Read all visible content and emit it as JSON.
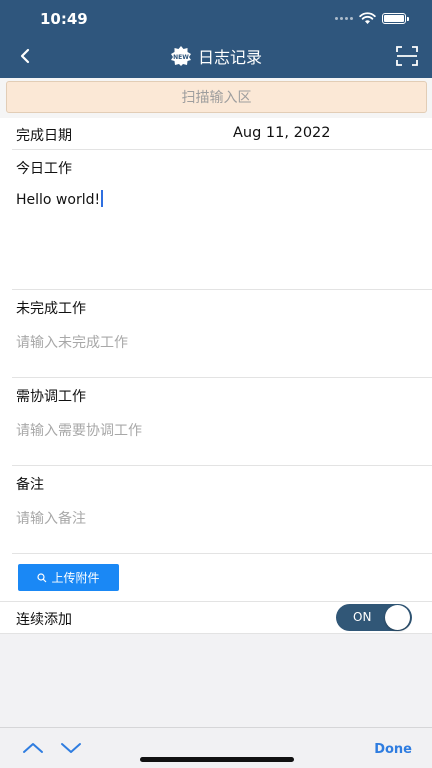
{
  "status": {
    "time": "10:49"
  },
  "header": {
    "title": "日志记录",
    "badge_text": "NEW"
  },
  "scan_area": {
    "label": "扫描输入区"
  },
  "form": {
    "completion_date": {
      "label": "完成日期",
      "value": "Aug 11, 2022"
    },
    "today_work": {
      "label": "今日工作",
      "value": "Hello world!"
    },
    "unfinished_work": {
      "label": "未完成工作",
      "placeholder": "请输入未完成工作"
    },
    "coordination_work": {
      "label": "需协调工作",
      "placeholder": "请输入需要协调工作"
    },
    "notes": {
      "label": "备注",
      "placeholder": "请输入备注"
    },
    "upload": {
      "label": "上传附件"
    },
    "continuous_add": {
      "label": "连续添加",
      "state_text": "ON",
      "enabled": true
    }
  },
  "keyboard_toolbar": {
    "done_label": "Done"
  },
  "colors": {
    "header_bg": "#2f567d",
    "accent_blue": "#1a88f5",
    "toggle_bg": "#315777",
    "scan_bg": "#fbe8d6"
  }
}
